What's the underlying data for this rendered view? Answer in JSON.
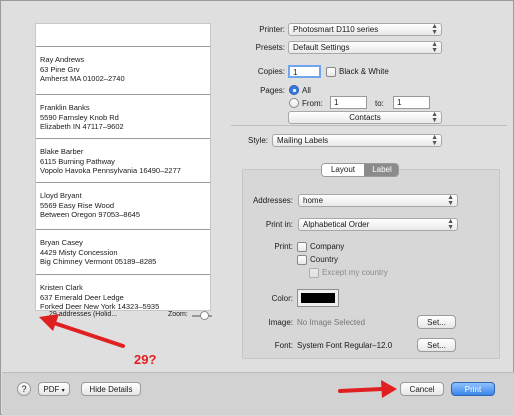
{
  "preview": {
    "labels": [
      {
        "name": "Ray Andrews",
        "line1": "63 Pine Grv",
        "line2": "Amherst MA 01002–2740"
      },
      {
        "name": "Franklin Banks",
        "line1": "5590 Farnsley Knob Rd",
        "line2": "Elizabeth IN 47117–9602"
      },
      {
        "name": "Blake Barber",
        "line1": "6115 Burning Pathway",
        "line2": "Vopolo Havoka Pennsylvania 16490–2277"
      },
      {
        "name": "Lloyd Bryant",
        "line1": "5569 Easy Rise Wood",
        "line2": "Between Oregon 97053–8645"
      },
      {
        "name": "Bryan Casey",
        "line1": "4429 Misty Concession",
        "line2": "Big Chimney Vermont 05189–8285"
      },
      {
        "name": "Kristen Clark",
        "line1": "637 Emerald Deer Ledge",
        "line2": "Forked Deer New York 14323–5935"
      }
    ],
    "count_text": "29 addresses (Holid...",
    "zoom_label": "Zoom:"
  },
  "printer": {
    "label": "Printer:",
    "value": "Photosmart D110 series"
  },
  "presets": {
    "label": "Presets:",
    "value": "Default Settings"
  },
  "copies": {
    "label": "Copies:",
    "value": "1",
    "bw_label": "Black & White"
  },
  "pages": {
    "label": "Pages:",
    "all_label": "All",
    "from_label": "From:",
    "from_value": "1",
    "to_label": "to:",
    "to_value": "1"
  },
  "app_popup": {
    "value": "Contacts"
  },
  "style": {
    "label": "Style:",
    "value": "Mailing Labels"
  },
  "tabs": {
    "layout": "Layout",
    "label": "Label"
  },
  "addresses": {
    "label": "Addresses:",
    "value": "home"
  },
  "print_in": {
    "label": "Print in:",
    "value": "Alphabetical Order"
  },
  "print": {
    "label": "Print:",
    "company": "Company",
    "country": "Country",
    "except": "Except my country"
  },
  "color": {
    "label": "Color:",
    "swatch": "#000000"
  },
  "image": {
    "label": "Image:",
    "value": "No Image Selected",
    "set": "Set..."
  },
  "font": {
    "label": "Font:",
    "value": "System Font Regular–12.0",
    "set": "Set..."
  },
  "bottom": {
    "help": "?",
    "pdf": "PDF",
    "hide": "Hide Details",
    "cancel": "Cancel",
    "print": "Print"
  },
  "annotation": {
    "text": "29?",
    "color": "#e02020"
  }
}
